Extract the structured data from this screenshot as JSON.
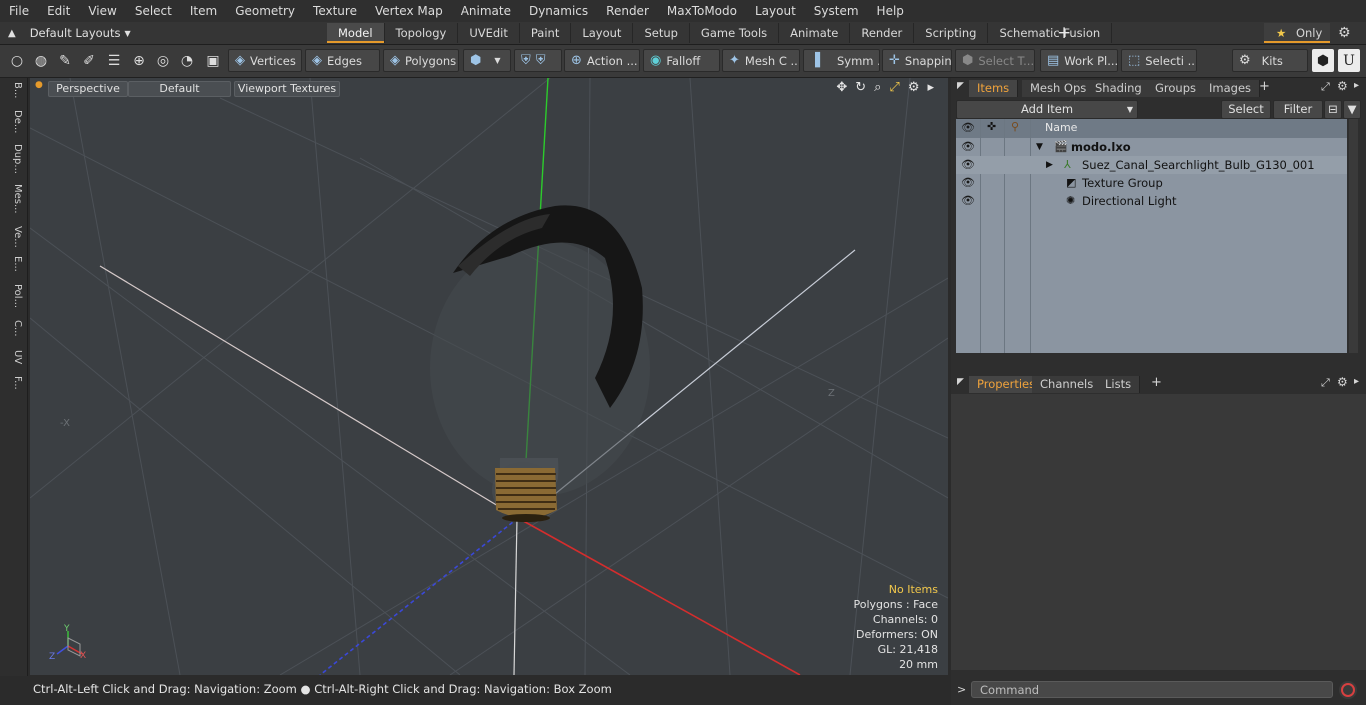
{
  "menu": [
    "File",
    "Edit",
    "View",
    "Select",
    "Item",
    "Geometry",
    "Texture",
    "Vertex Map",
    "Animate",
    "Dynamics",
    "Render",
    "MaxToModo",
    "Layout",
    "System",
    "Help"
  ],
  "layouts": {
    "label": "Default Layouts",
    "arrow_icon": "up-arrow-icon"
  },
  "tabs": [
    "Model",
    "Topology",
    "UVEdit",
    "Paint",
    "Layout",
    "Setup",
    "Game Tools",
    "Animate",
    "Render",
    "Scripting",
    "Schematic Fusion"
  ],
  "only_label": "Only",
  "toolbar": {
    "vertices": "Vertices",
    "edges": "Edges",
    "polygons": "Polygons",
    "action": "Action ...",
    "falloff": "Falloff",
    "mesh": "Mesh C ...",
    "symm": "Symm ...",
    "snapping": "Snapping",
    "select_t": "Select T...",
    "work_pl": "Work Pl...",
    "selecti": "Selecti ...",
    "kits": "Kits"
  },
  "left_tabs": [
    "B...",
    "De...",
    "Dup...",
    "Mes...",
    "Ve...",
    "E...",
    "Pol...",
    "C...",
    "UV",
    "F..."
  ],
  "viewport": {
    "perspective": "Perspective",
    "default": "Default",
    "textures": "Viewport Textures",
    "axis_label_z": "Z",
    "axis_label_x": "X",
    "stats": [
      "No Items",
      "Polygons : Face",
      "Channels: 0",
      "Deformers: ON",
      "GL: 21,418",
      "20 mm"
    ]
  },
  "status_text": "Ctrl-Alt-Left Click and Drag: Navigation: Zoom ● Ctrl-Alt-Right Click and Drag: Navigation: Box Zoom",
  "items_panel": {
    "tabs": [
      "Items",
      "Mesh Ops",
      "Shading",
      "Groups",
      "Images"
    ],
    "add_item": "Add Item",
    "select": "Select",
    "filter": "Filter",
    "column_name": "Name",
    "rows": [
      {
        "label": "modo.lxo",
        "bold": true
      },
      {
        "label": "Suez_Canal_Searchlight_Bulb_G130_001"
      },
      {
        "label": "Texture Group"
      },
      {
        "label": "Directional Light"
      }
    ]
  },
  "properties_panel": {
    "tabs": [
      "Properties",
      "Channels",
      "Lists"
    ]
  },
  "command_placeholder": "Command",
  "colors": {
    "accent": "#e59a2b",
    "items_bg": "#8b95a1",
    "viewport_bg": "#3b3f43"
  }
}
